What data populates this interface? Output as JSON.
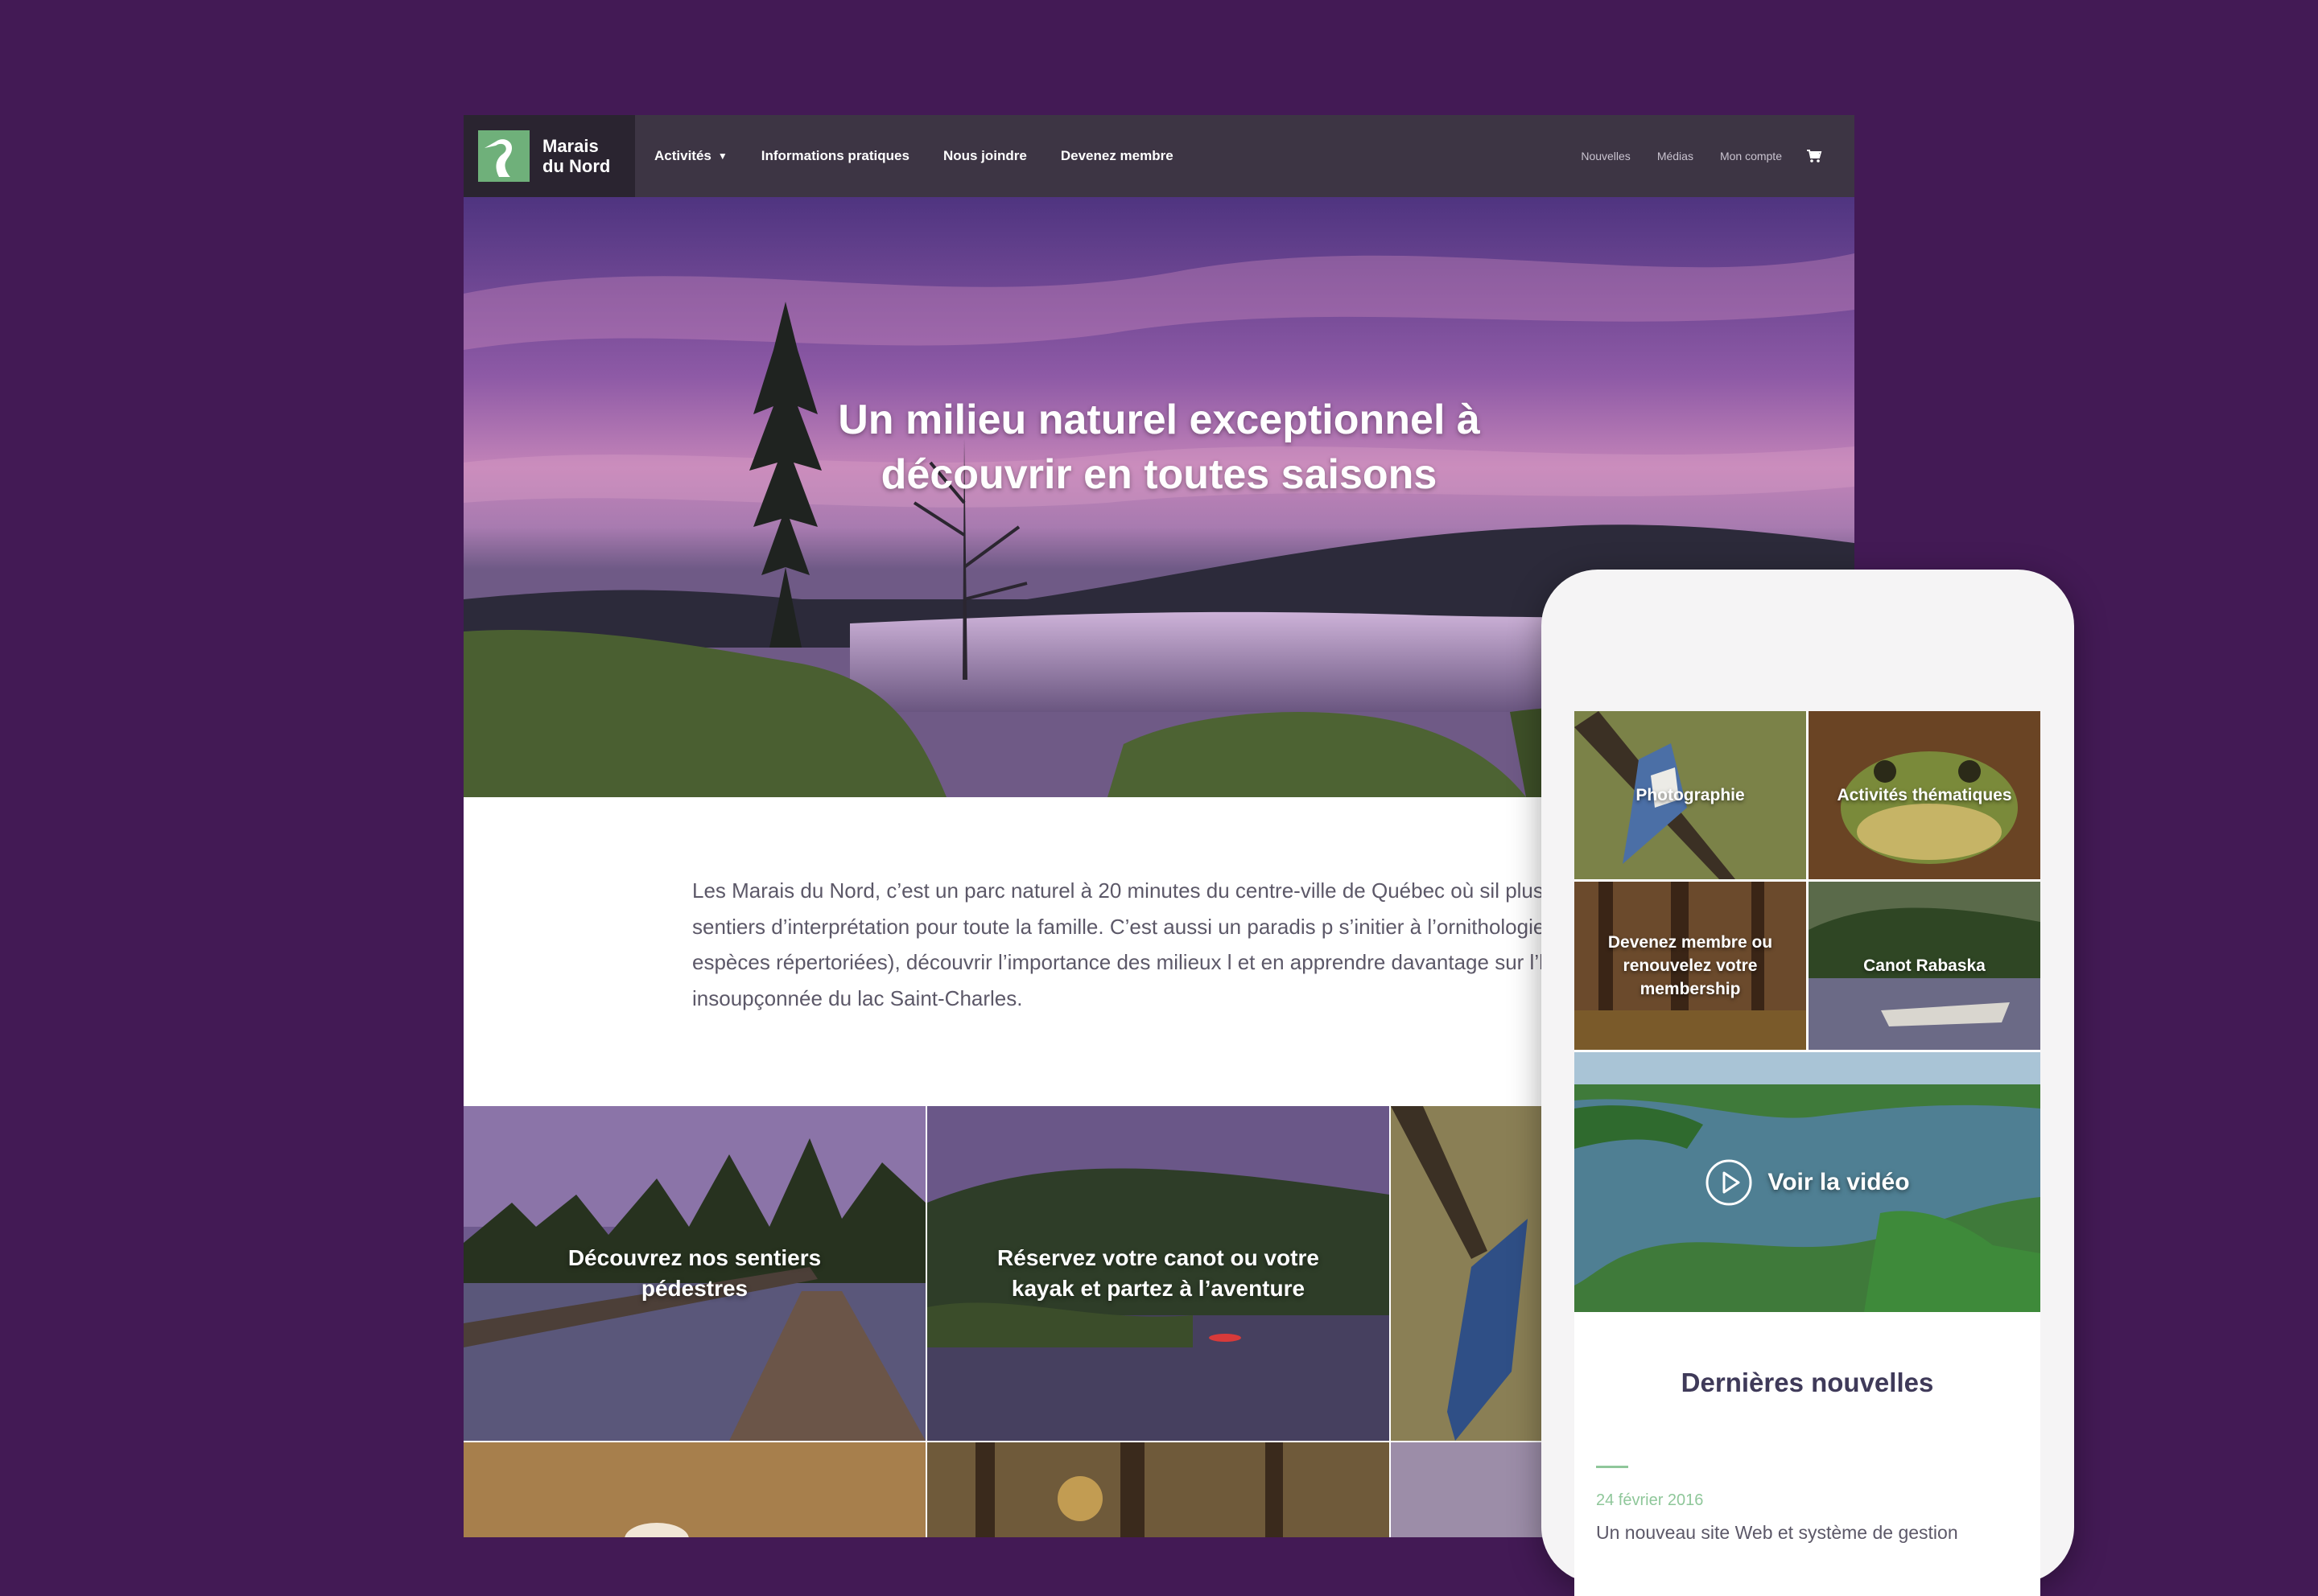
{
  "site": {
    "logo_line1": "Marais",
    "logo_line2": "du Nord",
    "nav_main": [
      "Activités",
      "Informations pratiques",
      "Nous joindre",
      "Devenez membre"
    ],
    "nav_secondary": [
      "Nouvelles",
      "Médias",
      "Mon compte"
    ],
    "cart_icon": "cart-icon",
    "logo_icon": "heron-logo-icon"
  },
  "hero": {
    "title": "Un milieu naturel exceptionnel à découvrir en toutes saisons"
  },
  "intro": {
    "text": "Les Marais du Nord, c’est un parc naturel à 20 minutes du centre-ville de Québec où sil plus de 8 km de sentiers d’interprétation pour toute la famille. C’est aussi un paradis p s’initier à l’ornithologie (160 espèces répertoriées), découvrir l’importance des milieux l et en apprendre davantage sur l’histoire insoupçonnée du lac Saint-Charles."
  },
  "tiles": [
    {
      "label": "Découvrez nos sentiers pédestres"
    },
    {
      "label": "Réservez votre canot ou votre kayak et partez à l’aventure"
    }
  ],
  "mobile": {
    "tiles": [
      {
        "label": "Photographie"
      },
      {
        "label": "Activités thématiques"
      },
      {
        "label": "Devenez membre ou renouvelez votre membership"
      },
      {
        "label": "Canot Rabaska"
      }
    ],
    "video_label": "Voir la vidéo",
    "news_title": "Dernières nouvelles",
    "news_date": "24 février 2016",
    "news_headline": "Un nouveau site Web et système de gestion"
  },
  "colors": {
    "background": "#431a55",
    "navbar": "#3d3544",
    "accent_green": "#6fb07a"
  }
}
